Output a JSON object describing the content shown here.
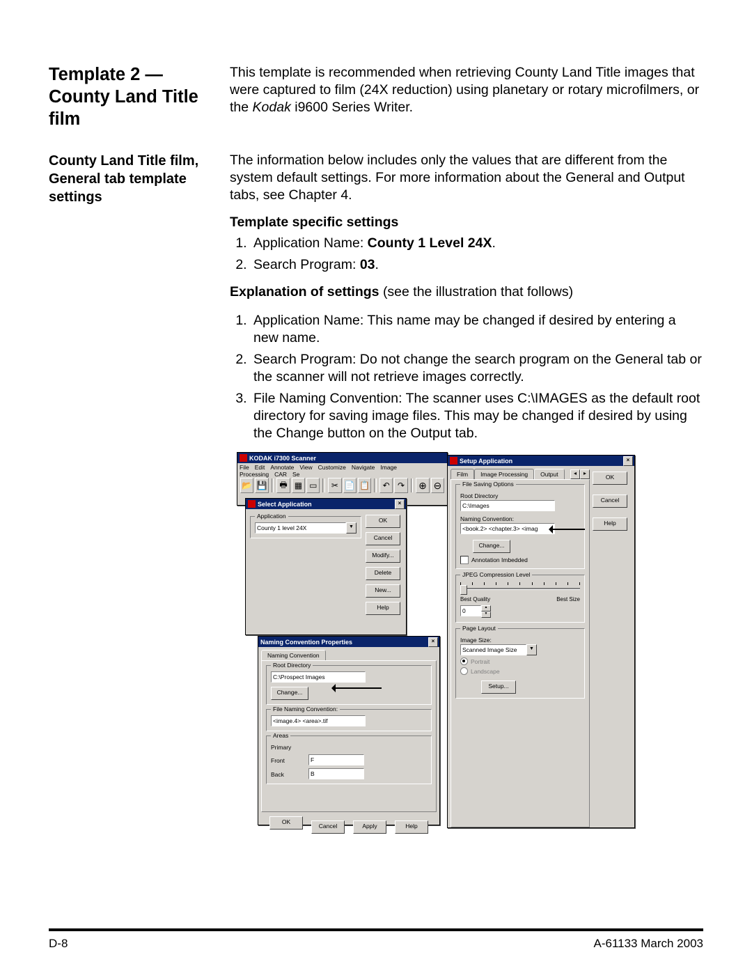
{
  "header": {
    "title": "Template 2 — County Land Title film",
    "intro": "This template is recommended when retrieving County Land Title images that were captured to film (24X reduction) using planetary or rotary microfilmers, or the ",
    "intro_italic": "Kodak ",
    "intro_tail": "i9600 Series Writer."
  },
  "section": {
    "subtitle": "County Land Title film, General tab template settings",
    "para1": "The information below includes only the values that are different from the system default settings.  For more information about the General and Output tabs, see Chapter 4.",
    "settings_head": "Template specific settings",
    "setting1_pre": "Application Name: ",
    "setting1_bold": "County 1 Level 24X",
    "setting1_post": ".",
    "setting2_pre": "Search Program: ",
    "setting2_bold": "03",
    "setting2_post": ".",
    "explain_head": "Explanation of settings ",
    "explain_tail": "(see the illustration that follows)",
    "exp1": "Application Name: This name may be changed if desired by entering a new name.",
    "exp2": "Search Program: Do not change the search program on the General tab or the scanner will not retrieve images correctly.",
    "exp3": "File Naming Convention: The scanner uses C:\\IMAGES as the default root directory for saving image files. This may be changed if desired by using the Change button on the Output tab."
  },
  "win1": {
    "title": "KODAK i7300 Scanner",
    "menu": [
      "File",
      "Edit",
      "Annotate",
      "View",
      "Customize",
      "Navigate",
      "Image Processing",
      "CAR",
      "Se"
    ]
  },
  "win2": {
    "title": "Select Application",
    "group": "Application",
    "app_value": "County 1 level 24X",
    "buttons": [
      "OK",
      "Cancel",
      "Modify...",
      "Delete",
      "New...",
      "Help"
    ]
  },
  "win3": {
    "title": "Naming Convention Properties",
    "tab": "Naming Convention",
    "root_label": "Root Directory",
    "root_value": "C:\\Prospect Images",
    "change": "Change...",
    "fnc_label": "File Naming Convention:",
    "fnc_value": "<image.4> <area>.tif",
    "areas_label": "Areas",
    "primary": "Primary",
    "front": "Front",
    "front_v": "F",
    "back": "Back",
    "back_v": "B",
    "buttons": [
      "OK",
      "Cancel",
      "Apply",
      "Help"
    ]
  },
  "win4": {
    "title": "Setup Application",
    "tabs": [
      "Film",
      "Image Processing",
      "Output"
    ],
    "side_buttons": [
      "OK",
      "Cancel",
      "Help"
    ],
    "fso": "File Saving Options",
    "root_label": "Root Directory",
    "root_value": "C:\\Images",
    "nc_label": "Naming Convention:",
    "nc_value": "<book.2> <chapter.3> <imag",
    "change": "Change...",
    "anno": "Annotation Imbedded",
    "jpeg_label": "JPEG Compression Level",
    "bq": "Best Quality",
    "bs": "Best Size",
    "jpeg_value": "0",
    "layout_label": "Page Layout",
    "img_size": "Image Size:",
    "img_size_v": "Scanned Image Size",
    "portrait": "Portrait",
    "landscape": "Landscape",
    "setup": "Setup..."
  },
  "footer": {
    "left": "D-8",
    "right": "A-61133  March 2003"
  }
}
